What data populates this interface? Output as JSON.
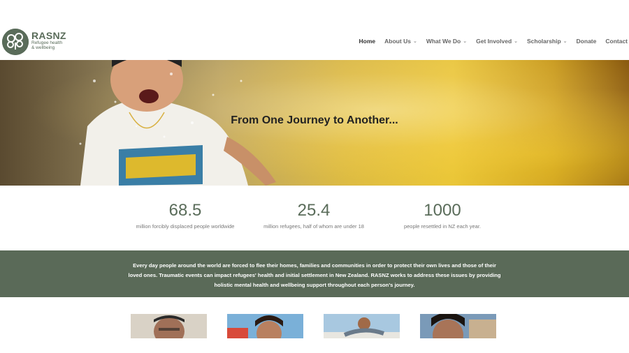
{
  "logo": {
    "name": "RASNZ",
    "tagline_line1": "Refugee health",
    "tagline_line2": "& wellbeing"
  },
  "nav": {
    "items": [
      {
        "label": "Home",
        "has_dropdown": false,
        "active": true
      },
      {
        "label": "About Us",
        "has_dropdown": true
      },
      {
        "label": "What We Do",
        "has_dropdown": true
      },
      {
        "label": "Get Involved",
        "has_dropdown": true
      },
      {
        "label": "Scholarship",
        "has_dropdown": true
      },
      {
        "label": "Donate",
        "has_dropdown": false
      },
      {
        "label": "Contact",
        "has_dropdown": false
      }
    ]
  },
  "hero": {
    "title": "From One Journey to Another..."
  },
  "stats": [
    {
      "value": "68.5",
      "label": "million forcibly displaced people worldwide"
    },
    {
      "value": "25.4",
      "label": "million refugees, half of whom are under 18"
    },
    {
      "value": "1000",
      "label": "people resettled in NZ each year."
    }
  ],
  "mission": {
    "text": "Every day people around the world are forced to flee their homes, families and communities in order to protect their own lives and those of their loved ones. Traumatic events can impact refugees' health and initial settlement in New Zealand. RASNZ works to address these issues by providing holistic mental health and wellbeing support throughout each person's journey."
  },
  "colors": {
    "brand_green": "#5a6c5a",
    "mission_band": "#5a6a58"
  },
  "icons": {
    "logo": "tree-logo-icon",
    "dropdown": "chevron-down-icon"
  }
}
